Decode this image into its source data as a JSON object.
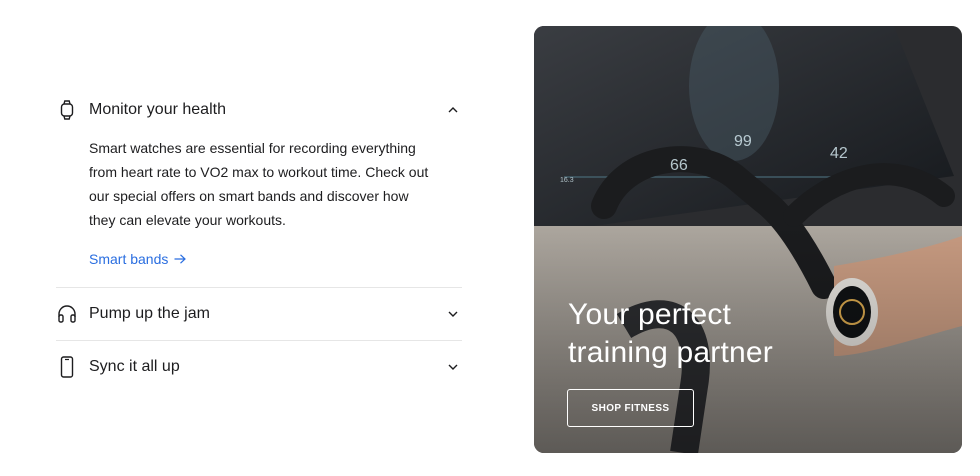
{
  "accordion": {
    "items": [
      {
        "title": "Monitor your health",
        "icon": "smartwatch-icon",
        "expanded": true,
        "body": "Smart watches are essential for recording everything from heart rate to VO2 max to workout time. Check out our special offers on smart bands and discover how they can elevate your workouts.",
        "link_label": "Smart bands"
      },
      {
        "title": "Pump up the jam",
        "icon": "headphones-icon",
        "expanded": false
      },
      {
        "title": "Sync it all up",
        "icon": "smartphone-icon",
        "expanded": false
      }
    ]
  },
  "hero": {
    "title_line1": "Your perfect",
    "title_line2": "training partner",
    "button_label": "SHOP FITNESS",
    "screen_readouts": [
      "66",
      "99",
      "42",
      "16.3"
    ]
  },
  "colors": {
    "link": "#2a6ee0",
    "text": "#1d1d1f",
    "divider": "#e6e6e6"
  }
}
